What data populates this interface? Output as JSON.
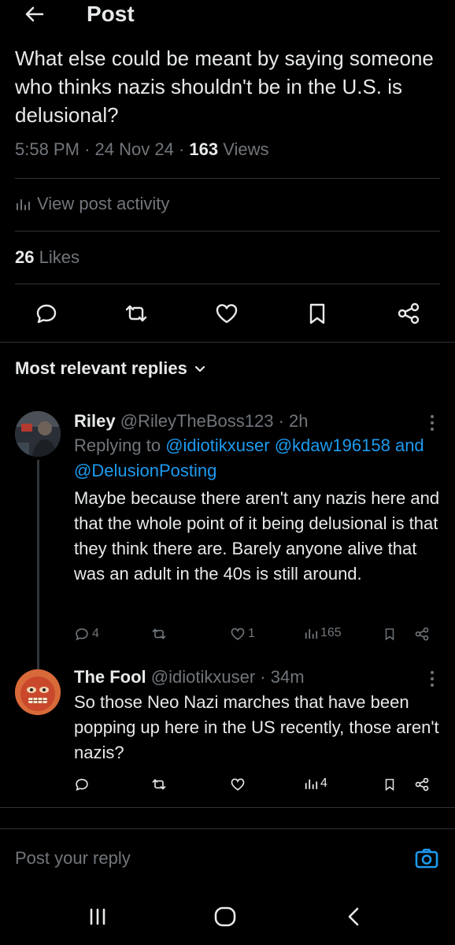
{
  "header": {
    "title": "Post"
  },
  "post": {
    "text": "What else could be meant by saying someone who thinks nazis shouldn't be in the U.S. is delusional?",
    "time": "5:58 PM",
    "sep1": "·",
    "date": "24 Nov 24",
    "sep2": "·",
    "views_count": "163",
    "views_label": "Views",
    "activity_label": "View post activity",
    "likes_count": "26",
    "likes_label": "Likes"
  },
  "sort_label": "Most relevant replies",
  "replies": [
    {
      "name": "Riley",
      "handle": "@RileyTheBoss123",
      "time": "· 2h",
      "replying_prefix": "Replying to",
      "mention1": "@idiotikxuser",
      "mention2": "@kdaw196158",
      "and": "and",
      "mention3": "@DelusionPosting",
      "text": "Maybe because there aren't any nazis here and that the whole point of it being delusional is that they think there are. Barely anyone alive that was an adult in the 40s is still around.",
      "replies_count": "4",
      "likes_count": "1",
      "views_count": "165"
    },
    {
      "name": "The Fool",
      "handle": "@idiotikxuser",
      "time": "· 34m",
      "text": "So those Neo Nazi marches that have been popping up here in the US recently, those aren't nazis?",
      "views_count": "4"
    }
  ],
  "compose": {
    "placeholder": "Post your reply"
  },
  "colors": {
    "accent": "#1d9bf0",
    "background": "#000000",
    "muted": "#71767b",
    "text": "#e7e9ea"
  }
}
